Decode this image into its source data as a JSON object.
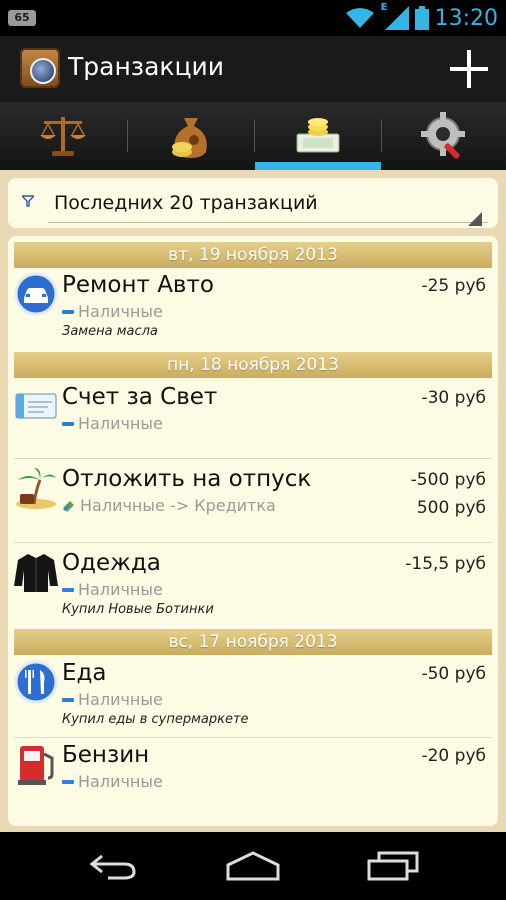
{
  "status_bar": {
    "badge": "65",
    "network_type": "E",
    "time": "13:20",
    "accent_color": "#33b5e5"
  },
  "action_bar": {
    "title": "Транзакции",
    "add_icon": "plus-icon"
  },
  "tabs": [
    {
      "name": "balance",
      "icon": "scales-icon",
      "selected": false
    },
    {
      "name": "money",
      "icon": "money-bag-icon",
      "selected": false
    },
    {
      "name": "transactions",
      "icon": "coins-icon",
      "selected": true
    },
    {
      "name": "settings",
      "icon": "gear-icon",
      "selected": false
    }
  ],
  "filter": {
    "label": "Последних 20 транзакций"
  },
  "groups": [
    {
      "date": "вт, 19 ноября 2013",
      "items": [
        {
          "title": "Ремонт Авто",
          "icon": "car-icon",
          "amount": "-25 руб",
          "account": "Наличные",
          "note": "Замена масла"
        }
      ]
    },
    {
      "date": "пн, 18 ноября 2013",
      "items": [
        {
          "title": "Счет за Свет",
          "icon": "bill-icon",
          "amount": "-30 руб",
          "account": "Наличные",
          "note": ""
        },
        {
          "title": "Отложить на отпуск",
          "icon": "palm-island-icon",
          "amount": "-500 руб",
          "amount2": "500 руб",
          "account": "Наличные -> Кредитка",
          "note": ""
        },
        {
          "title": "Одежда",
          "icon": "jacket-icon",
          "amount": "-15,5 руб",
          "account": "Наличные",
          "note": "Купил Новые Ботинки"
        }
      ]
    },
    {
      "date": "вс, 17 ноября 2013",
      "items": [
        {
          "title": "Еда",
          "icon": "fork-knife-icon",
          "amount": "-50 руб",
          "account": "Наличные",
          "note": "Купил еды в супермаркете"
        },
        {
          "title": "Бензин",
          "icon": "gas-pump-icon",
          "amount": "-20 руб",
          "account": "Наличные",
          "note": ""
        }
      ]
    }
  ],
  "nav_bar": {
    "back_icon": "back-icon",
    "home_icon": "home-icon",
    "recents_icon": "recents-icon"
  }
}
